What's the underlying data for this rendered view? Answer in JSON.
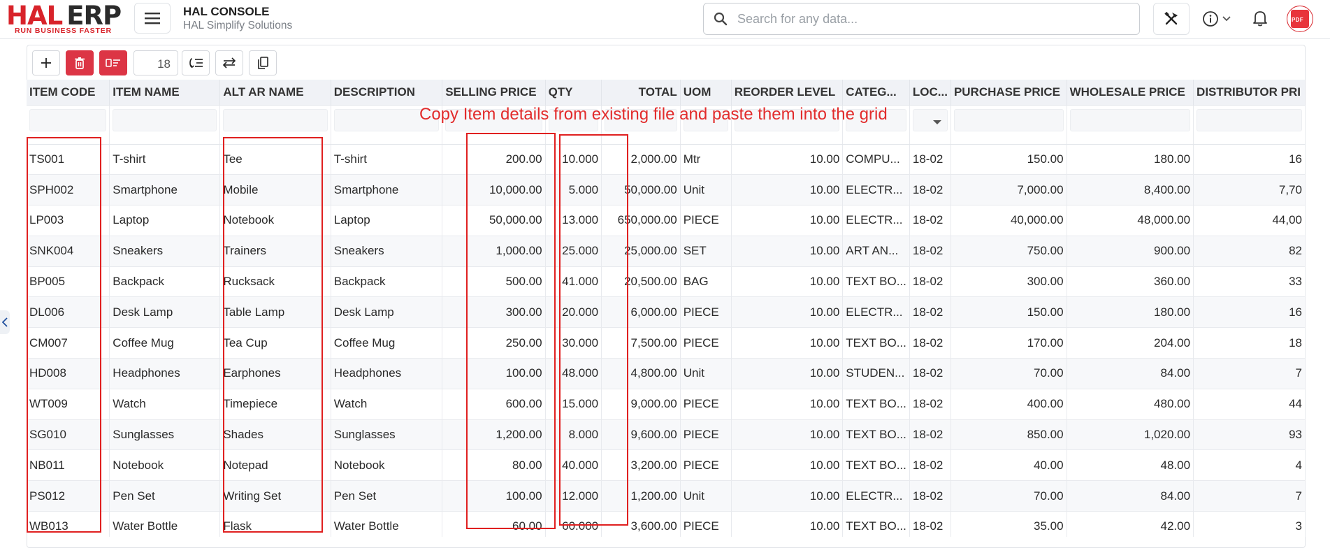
{
  "brand": {
    "logo_main_1": "HAL",
    "logo_main_2": "ERP",
    "tagline": "RUN BUSINESS FASTER"
  },
  "header": {
    "title": "HAL CONSOLE",
    "subtitle": "HAL Simplify Solutions",
    "search_placeholder": "Search for any data...",
    "avatar_text": "PDF"
  },
  "toolbar": {
    "page_size": "18"
  },
  "annotation": "Copy Item details from existing file and paste them into the grid",
  "grid": {
    "columns": [
      "ITEM CODE",
      "ITEM NAME",
      "ALT AR NAME",
      "DESCRIPTION",
      "SELLING PRICE",
      "QTY",
      "TOTAL",
      "UOM",
      "REORDER LEVEL",
      "CATEG...",
      "LOC...",
      "PURCHASE PRICE",
      "WHOLESALE PRICE",
      "DISTRIBUTOR PRI"
    ],
    "rows": [
      [
        "TS001",
        "T-shirt",
        "Tee",
        "T-shirt",
        "200.00",
        "10.000",
        "2,000.00",
        "Mtr",
        "10.00",
        "COMPU...",
        "18-02",
        "150.00",
        "180.00",
        "16"
      ],
      [
        "SPH002",
        "Smartphone",
        "Mobile",
        "Smartphone",
        "10,000.00",
        "5.000",
        "50,000.00",
        "Unit",
        "10.00",
        "ELECTR...",
        "18-02",
        "7,000.00",
        "8,400.00",
        "7,70"
      ],
      [
        "LP003",
        "Laptop",
        "Notebook",
        "Laptop",
        "50,000.00",
        "13.000",
        "650,000.00",
        "PIECE",
        "10.00",
        "ELECTR...",
        "18-02",
        "40,000.00",
        "48,000.00",
        "44,00"
      ],
      [
        "SNK004",
        "Sneakers",
        "Trainers",
        "Sneakers",
        "1,000.00",
        "25.000",
        "25,000.00",
        "SET",
        "10.00",
        "ART AN...",
        "18-02",
        "750.00",
        "900.00",
        "82"
      ],
      [
        "BP005",
        "Backpack",
        "Rucksack",
        "Backpack",
        "500.00",
        "41.000",
        "20,500.00",
        "BAG",
        "10.00",
        "TEXT BO...",
        "18-02",
        "300.00",
        "360.00",
        "33"
      ],
      [
        "DL006",
        "Desk Lamp",
        "Table Lamp",
        "Desk Lamp",
        "300.00",
        "20.000",
        "6,000.00",
        "PIECE",
        "10.00",
        "ELECTR...",
        "18-02",
        "150.00",
        "180.00",
        "16"
      ],
      [
        "CM007",
        "Coffee Mug",
        "Tea Cup",
        "Coffee Mug",
        "250.00",
        "30.000",
        "7,500.00",
        "PIECE",
        "10.00",
        "TEXT BO...",
        "18-02",
        "170.00",
        "204.00",
        "18"
      ],
      [
        "HD008",
        "Headphones",
        "Earphones",
        "Headphones",
        "100.00",
        "48.000",
        "4,800.00",
        "Unit",
        "10.00",
        "STUDEN...",
        "18-02",
        "70.00",
        "84.00",
        "7"
      ],
      [
        "WT009",
        "Watch",
        "Timepiece",
        "Watch",
        "600.00",
        "15.000",
        "9,000.00",
        "PIECE",
        "10.00",
        "TEXT BO...",
        "18-02",
        "400.00",
        "480.00",
        "44"
      ],
      [
        "SG010",
        "Sunglasses",
        "Shades",
        "Sunglasses",
        "1,200.00",
        "8.000",
        "9,600.00",
        "PIECE",
        "10.00",
        "TEXT BO...",
        "18-02",
        "850.00",
        "1,020.00",
        "93"
      ],
      [
        "NB011",
        "Notebook",
        "Notepad",
        "Notebook",
        "80.00",
        "40.000",
        "3,200.00",
        "PIECE",
        "10.00",
        "TEXT BO...",
        "18-02",
        "40.00",
        "48.00",
        "4"
      ],
      [
        "PS012",
        "Pen Set",
        "Writing Set",
        "Pen Set",
        "100.00",
        "12.000",
        "1,200.00",
        "Unit",
        "10.00",
        "ELECTR...",
        "18-02",
        "70.00",
        "84.00",
        "7"
      ],
      [
        "WB013",
        "Water Bottle",
        "Flask",
        "Water Bottle",
        "60.00",
        "60.000",
        "3,600.00",
        "PIECE",
        "10.00",
        "TEXT BO...",
        "18-02",
        "35.00",
        "42.00",
        "3"
      ]
    ]
  },
  "colors": {
    "brand_red": "#d8232a",
    "annotation_red": "#e22c2c",
    "header_bg": "#f0f2f6"
  }
}
